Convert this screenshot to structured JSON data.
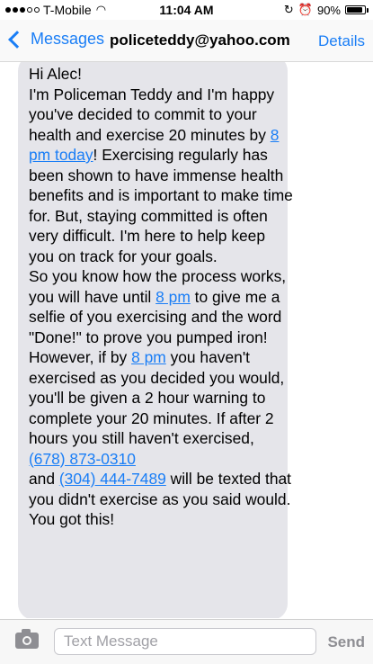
{
  "status_bar": {
    "carrier": "T-Mobile",
    "time": "11:04 AM",
    "battery": "90%",
    "battery_level": 0.9,
    "signal_bars_filled": 3,
    "signal_bars_total": 5
  },
  "nav": {
    "back_label": "Messages",
    "contact": "policeteddy@yahoo.com",
    "details_label": "Details"
  },
  "message": {
    "segments": [
      {
        "text": "Hi Alec!\nI'm Policeman Teddy and I'm happy you've decided to commit to your health and exercise 20 minutes by "
      },
      {
        "text": "8 pm today",
        "link": true
      },
      {
        "text": "! Exercising regularly has been shown to have immense health benefits and is important to make time for. But, staying committed is often very difficult. I'm here to help keep you on track for your goals.\nSo you know how the process works, you will have until "
      },
      {
        "text": "8 pm",
        "link": true
      },
      {
        "text": " to give me a selfie of you exercising and the word \"Done!\" to prove you pumped iron! However, if by "
      },
      {
        "text": "8 pm",
        "link": true
      },
      {
        "text": " you haven't exercised as you decided you would, you'll be given a 2 hour warning to complete your 20 minutes. If after 2 hours you still haven't exercised,  "
      },
      {
        "text": "(678) 873-0310",
        "link": true
      },
      {
        "text": "\nand "
      },
      {
        "text": "(304) 444-7489",
        "link": true
      },
      {
        "text": " will be texted that you didn't exercise as you said would.\nYou got this!"
      }
    ]
  },
  "compose": {
    "placeholder": "Text Message",
    "value": "",
    "send_label": "Send"
  },
  "colors": {
    "accent": "#1a7ef6",
    "bubble": "#e5e5ea"
  }
}
